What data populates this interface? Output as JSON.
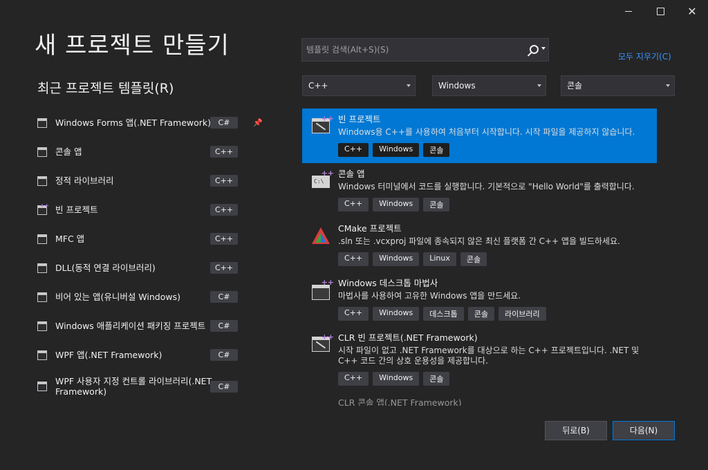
{
  "window": {
    "min_label": "",
    "max_label": "",
    "close_label": "✕"
  },
  "title": "새 프로젝트 만들기",
  "recent": {
    "heading": "최근 프로젝트 템플릿(R)",
    "items": [
      {
        "name": "Windows Forms 앱(.NET Framework)",
        "lang": "C#",
        "pinned": true
      },
      {
        "name": "콘솔 앱",
        "lang": "C++"
      },
      {
        "name": "정적 라이브러리",
        "lang": "C++"
      },
      {
        "name": "빈 프로젝트",
        "lang": "C++"
      },
      {
        "name": "MFC 앱",
        "lang": "C++"
      },
      {
        "name": "DLL(동적 연결 라이브러리)",
        "lang": "C++"
      },
      {
        "name": "비어 있는 앱(유니버설 Windows)",
        "lang": "C#"
      },
      {
        "name": "Windows 애플리케이션 패키징 프로젝트",
        "lang": "C#"
      },
      {
        "name": "WPF 앱(.NET Framework)",
        "lang": "C#"
      },
      {
        "name": "WPF 사용자 지정 컨트롤 라이브러리(.NET Framework)",
        "lang": "C#"
      }
    ],
    "pin_glyph": "📌"
  },
  "search": {
    "placeholder": "템플릿 검색(Alt+S)(S)",
    "value": ""
  },
  "clear_all": "모두 지우기(C)",
  "filters": {
    "language": "C++",
    "platform": "Windows",
    "project_type": "콘솔"
  },
  "templates": [
    {
      "name": "빈 프로젝트",
      "desc": "Windows용 C++를 사용하여 처음부터 시작합니다. 시작 파일을 제공하지 않습니다.",
      "tags": [
        "C++",
        "Windows",
        "콘솔"
      ],
      "selected": true
    },
    {
      "name": "콘솔 앱",
      "desc": "Windows 터미널에서 코드를 실행합니다. 기본적으로 \"Hello World\"를 출력합니다.",
      "tags": [
        "C++",
        "Windows",
        "콘솔"
      ]
    },
    {
      "name": "CMake 프로젝트",
      "desc": ".sln 또는 .vcxproj 파일에 종속되지 않은 최신 플랫폼 간 C++ 앱을 빌드하세요.",
      "tags": [
        "C++",
        "Windows",
        "Linux",
        "콘솔"
      ]
    },
    {
      "name": "Windows 데스크톱 마법사",
      "desc": "마법사를 사용하여 고유한 Windows 앱을 만드세요.",
      "tags": [
        "C++",
        "Windows",
        "데스크톱",
        "콘솔",
        "라이브러리"
      ]
    },
    {
      "name": "CLR 빈 프로젝트(.NET Framework)",
      "desc": "시작 파일이 없고 .NET Framework를 대상으로 하는 C++ 프로젝트입니다. .NET 및 C++ 코드 간의 상호 운용성을 제공합니다.",
      "tags": [
        "C++",
        "Windows",
        "콘솔"
      ]
    },
    {
      "name": "CLR 콘솔 앱(.NET Framework)",
      "desc": "",
      "tags": []
    }
  ],
  "buttons": {
    "back": "뒤로(B)",
    "next": "다음(N)"
  }
}
